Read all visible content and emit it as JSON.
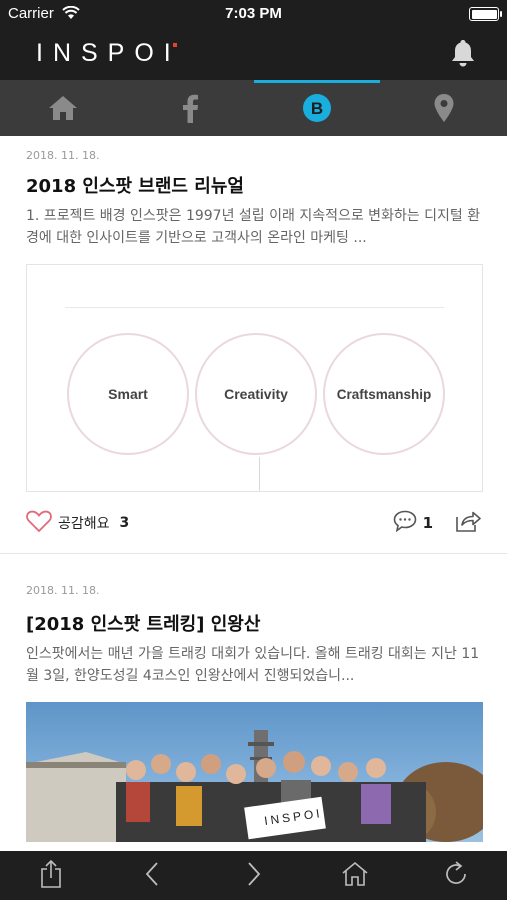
{
  "status_bar": {
    "carrier": "Carrier",
    "time": "7:03 PM"
  },
  "header": {
    "logo_text": "INSPOI",
    "accent_color": "#e8402e"
  },
  "tabs": [
    {
      "icon": "home-icon"
    },
    {
      "icon": "facebook-icon"
    },
    {
      "icon": "blog-b-icon",
      "active": true
    },
    {
      "icon": "location-pin-icon"
    }
  ],
  "posts": [
    {
      "date": "2018. 11. 18.",
      "title": "2018 인스팟 브랜드 리뉴얼",
      "excerpt": "1. 프로젝트 배경 인스팟은 1997년 설립 이래 지속적으로 변화하는 디지털 환경에 대한 인사이트를 기반으로 고객사의 온라인 마케팅 ...",
      "image_circles": [
        "Smart",
        "Creativity",
        "Craftsmanship"
      ],
      "like_label": "공감해요",
      "like_count": "3",
      "comment_count": "1"
    },
    {
      "date": "2018. 11. 18.",
      "title": "[2018 인스팟 트레킹] 인왕산",
      "excerpt": "인스팟에서는 매년 가을 트래킹 대회가 있습니다. 올해 트래킹 대회는 지난 11월 3일, 한양도성길 4코스인 인왕산에서 진행되었습니...",
      "banner_text": "INSPOI"
    }
  ],
  "bottom_bar": [
    "share-icon",
    "back-icon",
    "forward-icon",
    "home-icon",
    "refresh-icon"
  ],
  "colors": {
    "tab_active": "#1aaede",
    "dark_bg": "#1e1e1e",
    "tab_bg": "#3b3b3b"
  }
}
